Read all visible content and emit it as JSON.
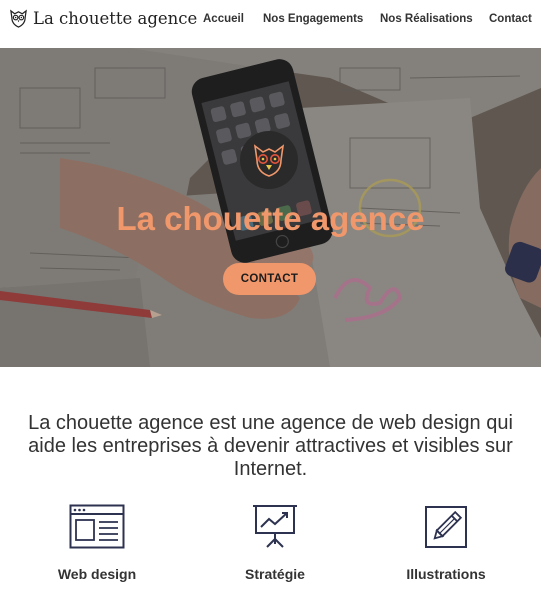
{
  "brand": {
    "name": "La chouette agence",
    "accent_color": "#f0976b",
    "icon": "owl-logo-icon"
  },
  "nav": {
    "items": [
      {
        "label": "Accueil"
      },
      {
        "label": "Nos Engagements"
      },
      {
        "label": "Nos Réalisations"
      },
      {
        "label": "Contact"
      }
    ]
  },
  "hero": {
    "title": "La chouette agence",
    "button_label": "CONTACT",
    "background": "photo of hands holding a smartphone over sketched wireframes",
    "badge_icon": "owl-logo-icon"
  },
  "intro": {
    "lines": [
      "La chouette agence est une agence de web design qui",
      "aide les entreprises à devenir attractives et visibles sur",
      "Internet."
    ]
  },
  "services": [
    {
      "label": "Web design",
      "icon": "browser-window-icon"
    },
    {
      "label": "Stratégie",
      "icon": "presentation-chart-icon"
    },
    {
      "label": "Illustrations",
      "icon": "pencil-edit-icon"
    }
  ]
}
